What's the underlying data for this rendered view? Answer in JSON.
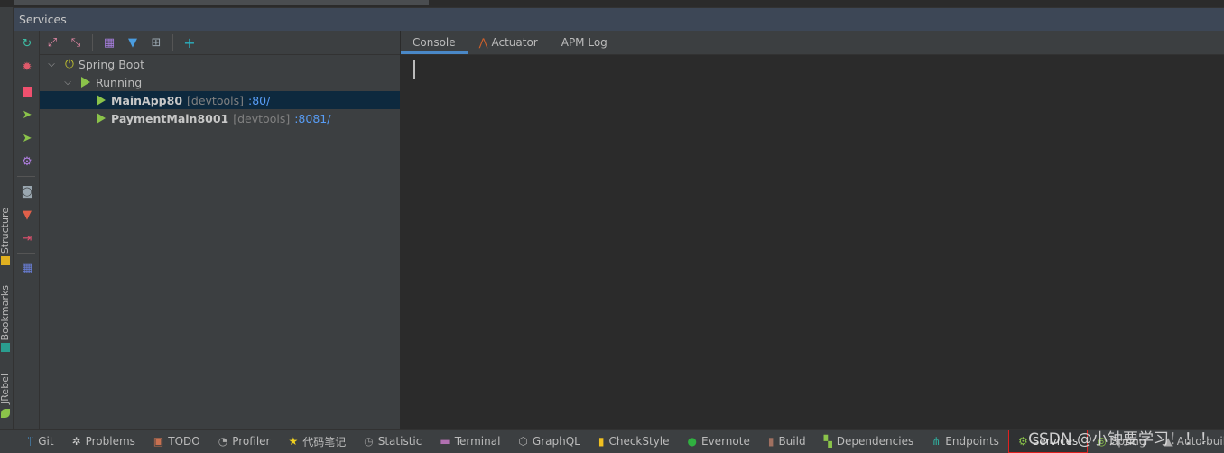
{
  "window": {
    "title": "Services"
  },
  "left_stripe": {
    "labels": [
      "Structure",
      "Bookmarks",
      "JRebel"
    ]
  },
  "actions": [
    {
      "icon": "rerun-icon",
      "color": "#3dbba3"
    },
    {
      "icon": "debug-icon",
      "color": "#e05a6b"
    },
    {
      "icon": "stop-icon",
      "color": "#f0506e"
    },
    {
      "icon": "run-jrebel-icon",
      "color": "#8bc34a"
    },
    {
      "icon": "debug-jrebel-icon",
      "color": "#8bc34a"
    },
    {
      "icon": "settings-icon",
      "color": "#b07fe0"
    },
    {
      "icon": "camera-icon",
      "color": "#9aa7b0"
    },
    {
      "icon": "plug-icon",
      "color": "#e0604a"
    },
    {
      "icon": "exit-icon",
      "color": "#e0506e"
    },
    {
      "icon": "layout-icon",
      "color": "#6a7fd8"
    }
  ],
  "tree": {
    "root": "Spring Boot",
    "group": "Running",
    "apps": [
      {
        "name": "MainApp80",
        "tag": "[devtools]",
        "port": ":80/",
        "selected": true
      },
      {
        "name": "PaymentMain8001",
        "tag": "[devtools]",
        "port": ":8081/",
        "selected": false
      }
    ]
  },
  "console": {
    "tabs": [
      "Console",
      "Actuator",
      "APM Log"
    ],
    "active_tab": "Console"
  },
  "bottom": {
    "items": [
      "Git",
      "Problems",
      "TODO",
      "Profiler",
      "代码笔记",
      "Statistic",
      "Terminal",
      "GraphQL",
      "CheckStyle",
      "Evernote",
      "Build",
      "Dependencies",
      "Endpoints",
      "Services",
      "Spring",
      "Auto-build"
    ],
    "active": "Services"
  },
  "watermark": "CSDN @小钟要学习！！！"
}
